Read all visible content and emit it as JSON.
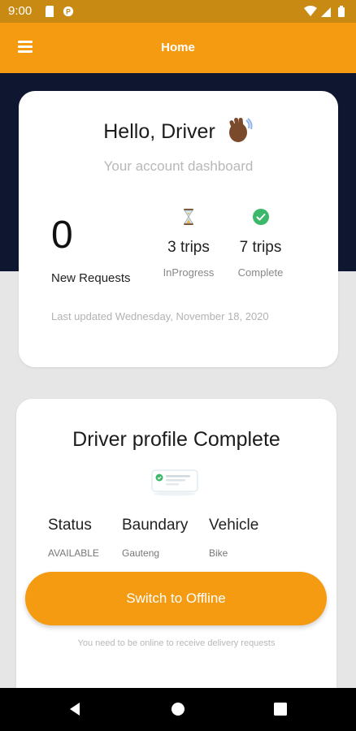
{
  "status_bar": {
    "time": "9:00",
    "icons": [
      "sd-card-icon",
      "p-badge-icon",
      "wifi-icon",
      "signal-icon",
      "battery-icon"
    ]
  },
  "app_bar": {
    "title": "Home",
    "menu_icon": "menu-icon"
  },
  "dashboard_card": {
    "greeting": "Hello, Driver",
    "greeting_icon": "waving-hand-icon",
    "subtitle": "Your account dashboard",
    "new_requests": {
      "count": "0",
      "label": "New Requests"
    },
    "in_progress": {
      "icon": "hourglass-icon",
      "value": "3 trips",
      "label": "InProgress"
    },
    "complete": {
      "icon": "check-circle-icon",
      "value": "7 trips",
      "label": "Complete"
    },
    "last_updated": "Last updated Wednesday, November 18, 2020"
  },
  "profile_card": {
    "title": "Driver profile Complete",
    "illustration": "profile-complete-illustration",
    "status": {
      "label": "Status",
      "value": "AVAILABLE"
    },
    "boundary": {
      "label": "Baundary",
      "value": "Gauteng"
    },
    "vehicle": {
      "label": "Vehicle",
      "value": "Bike"
    },
    "switch_button": "Switch to Offline",
    "hint": "You need to be online to receive delivery requests"
  },
  "nav_bar": {
    "icons": [
      "back-icon",
      "home-icon",
      "recents-icon"
    ]
  },
  "colors": {
    "accent": "#f49b12",
    "status_bar": "#c98a14",
    "header_band": "#0f1630",
    "success": "#3bb86a"
  }
}
